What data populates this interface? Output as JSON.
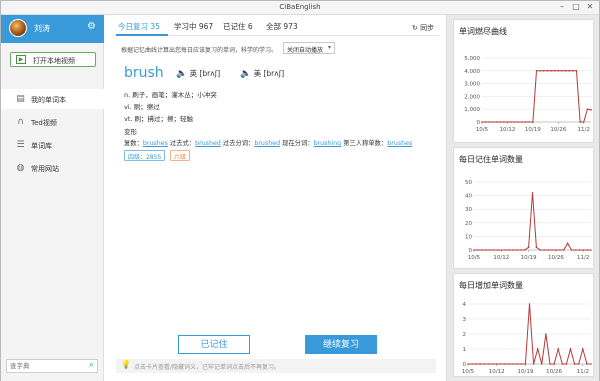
{
  "window": {
    "title": "CiBaEnglish",
    "controls": [
      "–",
      "□",
      "✕"
    ]
  },
  "user": {
    "name": "刘涛"
  },
  "sidebar": {
    "open_video": "打开本地视频",
    "items": [
      {
        "label": "我的单词本",
        "icon": "book-icon"
      },
      {
        "label": "Ted视频",
        "icon": "headphones-icon"
      },
      {
        "label": "单词库",
        "icon": "list-icon"
      },
      {
        "label": "常用网站",
        "icon": "globe-icon"
      }
    ],
    "search_placeholder": "查字典"
  },
  "main": {
    "tabs": [
      {
        "label": "今日复习 35"
      },
      {
        "label": "学习中 967"
      },
      {
        "label": "已记住 6"
      },
      {
        "label": "全部 973"
      }
    ],
    "sync": "同步",
    "hint": "根据记忆曲线计算出您每日应该复习的单词，科学的学习。",
    "autoplay": "关闭自动播放",
    "word": "brush",
    "pron_uk": "英 [brʌʃ]",
    "pron_us": "美 [brʌʃ]",
    "defs": [
      "n. 刷子，画笔；灌木丛；小冲突",
      "vi. 刷；擦过",
      "vt. 刷；拂过；擦；轻触",
      "变形"
    ],
    "forms": {
      "plural_label": "复数：",
      "plural": "brushes",
      "past_label": " 过去式：",
      "past": "brushed",
      "pp_label": " 过去分词：",
      "pp": "brushed",
      "ing_label": " 现在分词：",
      "ing": "brushing",
      "third_label": " 第三人称单数：",
      "third": "brushes"
    },
    "badges": [
      "四级：2855",
      "六级"
    ],
    "btn_remembered": "已记住",
    "btn_continue": "继续复习",
    "tip": "点击卡片查看/隐藏词义，已牢记单词点击后不再复习。"
  },
  "colors": {
    "accent": "#3a9ad9",
    "chart_line": "#b73a3a"
  },
  "chart_data": [
    {
      "type": "line",
      "title": "单词燃尽曲线",
      "x": [
        "10/5",
        "10/12",
        "10/19",
        "10/26",
        "11/2"
      ],
      "ylim": [
        0,
        5000
      ],
      "yticks": [
        "0",
        "1,000",
        "2,000",
        "3,000",
        "4,000",
        "5,000"
      ],
      "points": [
        [
          0,
          0
        ],
        [
          1,
          0
        ],
        [
          2,
          0
        ],
        [
          3,
          0
        ],
        [
          4,
          0
        ],
        [
          5,
          0
        ],
        [
          6,
          0
        ],
        [
          7,
          0
        ],
        [
          8,
          0
        ],
        [
          9,
          0
        ],
        [
          10,
          0
        ],
        [
          11,
          0
        ],
        [
          12,
          0
        ],
        [
          13,
          0
        ],
        [
          14,
          0
        ],
        [
          15,
          4000
        ],
        [
          16,
          4000
        ],
        [
          17,
          4000
        ],
        [
          18,
          4000
        ],
        [
          19,
          4000
        ],
        [
          20,
          4000
        ],
        [
          21,
          4000
        ],
        [
          22,
          4000
        ],
        [
          23,
          4000
        ],
        [
          24,
          4000
        ],
        [
          25,
          4000
        ],
        [
          26,
          4000
        ],
        [
          27,
          0
        ],
        [
          28,
          0
        ],
        [
          29,
          1000
        ],
        [
          30,
          950
        ]
      ]
    },
    {
      "type": "line",
      "title": "每日记住单词数量",
      "x": [
        "10/5",
        "10/12",
        "10/19",
        "10/26",
        "11/2"
      ],
      "ylim": [
        0,
        50
      ],
      "yticks": [
        "0",
        "10",
        "20",
        "30",
        "40",
        "50"
      ],
      "points": [
        [
          0,
          0
        ],
        [
          1,
          0
        ],
        [
          2,
          0
        ],
        [
          3,
          0
        ],
        [
          4,
          0
        ],
        [
          5,
          0
        ],
        [
          6,
          0
        ],
        [
          7,
          0
        ],
        [
          8,
          0
        ],
        [
          9,
          0
        ],
        [
          10,
          0
        ],
        [
          11,
          0
        ],
        [
          12,
          0
        ],
        [
          13,
          0
        ],
        [
          14,
          2
        ],
        [
          15,
          42
        ],
        [
          16,
          2
        ],
        [
          17,
          0
        ],
        [
          18,
          0
        ],
        [
          19,
          0
        ],
        [
          20,
          0
        ],
        [
          21,
          0
        ],
        [
          22,
          0
        ],
        [
          23,
          0
        ],
        [
          24,
          5
        ],
        [
          25,
          0
        ],
        [
          26,
          0
        ],
        [
          27,
          0
        ],
        [
          28,
          0
        ],
        [
          29,
          0
        ],
        [
          30,
          0
        ]
      ]
    },
    {
      "type": "line",
      "title": "每日增加单词数量",
      "x": [
        "10/5",
        "10/12",
        "10/19",
        "10/26",
        "11/2"
      ],
      "ylim": [
        0,
        4
      ],
      "yticks": [
        "0",
        "1",
        "2",
        "3",
        "4"
      ],
      "points": [
        [
          0,
          0
        ],
        [
          1,
          0
        ],
        [
          2,
          0
        ],
        [
          3,
          0
        ],
        [
          4,
          0
        ],
        [
          5,
          0
        ],
        [
          6,
          0
        ],
        [
          7,
          0
        ],
        [
          8,
          0
        ],
        [
          9,
          0
        ],
        [
          10,
          0
        ],
        [
          11,
          0
        ],
        [
          12,
          0
        ],
        [
          13,
          0
        ],
        [
          14,
          0
        ],
        [
          15,
          4
        ],
        [
          16,
          0
        ],
        [
          17,
          1
        ],
        [
          18,
          0
        ],
        [
          19,
          2
        ],
        [
          20,
          0
        ],
        [
          21,
          0
        ],
        [
          22,
          1
        ],
        [
          23,
          0
        ],
        [
          24,
          0
        ],
        [
          25,
          1
        ],
        [
          26,
          0
        ],
        [
          27,
          0
        ],
        [
          28,
          1
        ],
        [
          29,
          0
        ],
        [
          30,
          0
        ]
      ]
    }
  ]
}
